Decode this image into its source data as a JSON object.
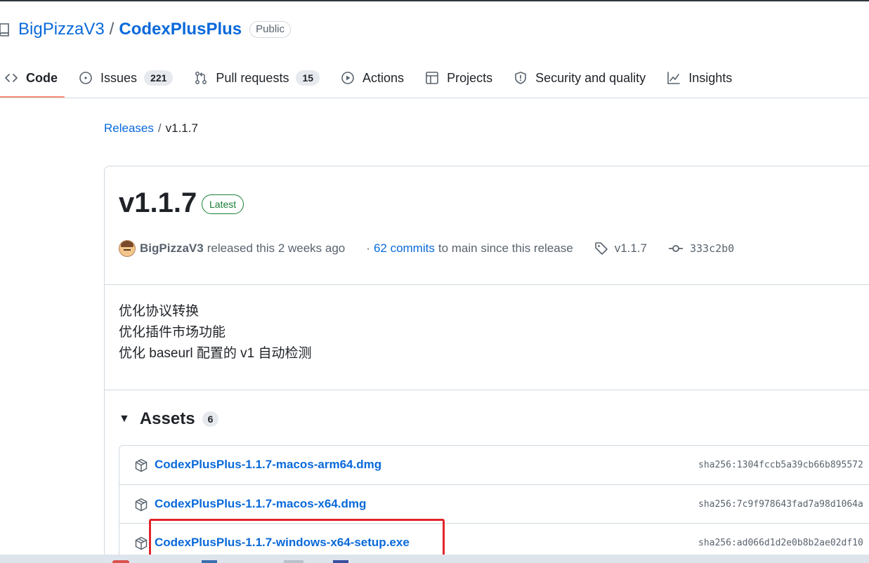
{
  "repo": {
    "owner": "BigPizzaV3",
    "slash": "/",
    "name": "CodexPlusPlus",
    "visibility": "Public"
  },
  "tabs": [
    {
      "label": "Code",
      "counter": null,
      "active": true
    },
    {
      "label": "Issues",
      "counter": "221"
    },
    {
      "label": "Pull requests",
      "counter": "15"
    },
    {
      "label": "Actions",
      "counter": null
    },
    {
      "label": "Projects",
      "counter": null
    },
    {
      "label": "Security and quality",
      "counter": null
    },
    {
      "label": "Insights",
      "counter": null
    }
  ],
  "breadcrumb": {
    "link": "Releases",
    "sep": "/",
    "current": "v1.1.7"
  },
  "release": {
    "title": "v1.1.7",
    "badge": "Latest",
    "author": "BigPizzaV3",
    "released_text": "released this 2 weeks ago",
    "dot": "·",
    "commits_link": "62 commits",
    "commits_suffix": "to main since this release",
    "tag": "v1.1.7",
    "commit_hash": "333c2b0",
    "notes": [
      "优化协议转换",
      "优化插件市场功能",
      "优化 baseurl 配置的 v1 自动检测"
    ]
  },
  "assets": {
    "caret": "▼",
    "title": "Assets",
    "count": "6",
    "items": [
      {
        "name": "CodexPlusPlus-1.1.7-macos-arm64.dmg",
        "sha": "sha256:1304fccb5a39cb66b895572"
      },
      {
        "name": "CodexPlusPlus-1.1.7-macos-x64.dmg",
        "sha": "sha256:7c9f978643fad7a98d1064a"
      },
      {
        "name": "CodexPlusPlus-1.1.7-windows-x64-setup.exe",
        "sha": "sha256:ad066d1d2e0b8b2ae02df10"
      }
    ]
  },
  "colors": {
    "link": "#0969da",
    "latest": "#1a7f37",
    "tab_underline": "#fd8c73",
    "highlight": "#e0262b"
  },
  "icons": {
    "repo": "repo-icon",
    "code": "code-icon",
    "issues": "issue-opened-icon",
    "pulls": "git-pull-request-icon",
    "actions": "play-icon",
    "projects": "table-icon",
    "security": "shield-icon",
    "insights": "graph-icon",
    "tag": "tag-icon",
    "commit": "git-commit-icon",
    "asset": "package-icon"
  }
}
